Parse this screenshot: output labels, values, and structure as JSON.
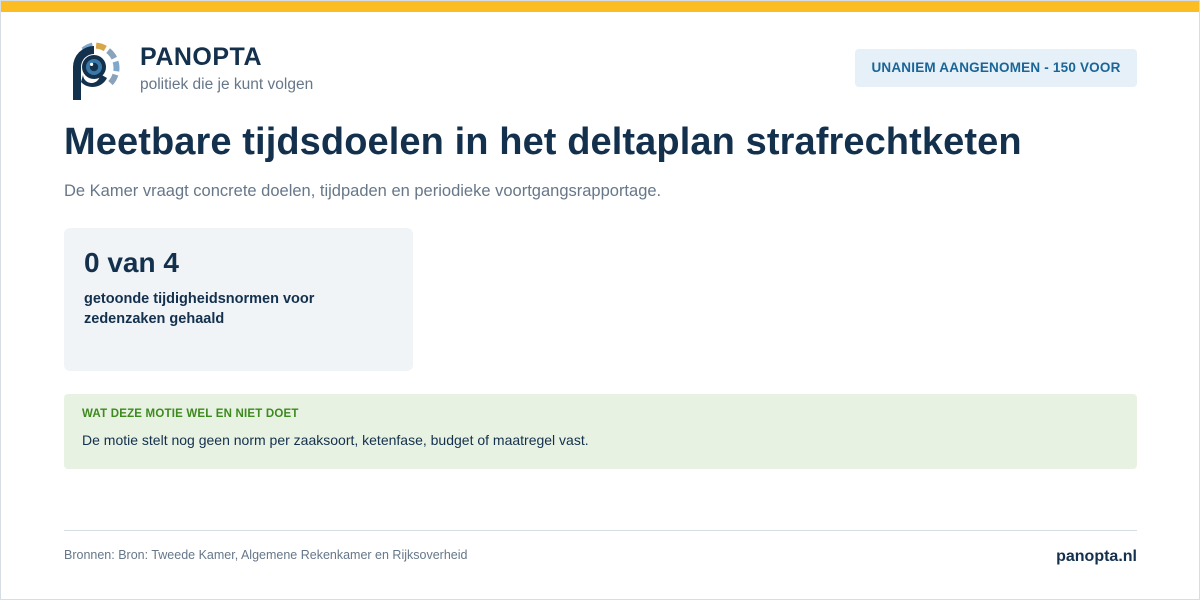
{
  "brand": {
    "name": "PANOPTA",
    "tagline": "politiek die je kunt volgen",
    "logo_icon": "panopta-eye-logo-icon"
  },
  "status": {
    "label": "UNANIEM AANGENOMEN - 150 VOOR"
  },
  "motion": {
    "title": "Meetbare tijdsdoelen in het deltaplan strafrechtketen",
    "summary": "De Kamer vraagt concrete doelen, tijdpaden en periodieke voortgangsrapportage."
  },
  "stat": {
    "value": "0 van 4",
    "label": "getoonde tijdigheidsnormen voor zedenzaken gehaald"
  },
  "info": {
    "heading": "WAT DEZE MOTIE WEL EN NIET DOET",
    "text": "De motie stelt nog geen norm per zaaksoort, ketenfase, budget of maatregel vast."
  },
  "footer": {
    "sources": "Bronnen: Bron: Tweede Kamer, Algemene Rekenkamer en Rijksoverheid",
    "site": "panopta.nl"
  },
  "colors": {
    "accent_bar": "#fbbd21",
    "navy": "#13304d",
    "muted": "#667789",
    "badge_bg": "#e6f0f8",
    "badge_text": "#1a6597",
    "card_bg": "#f1f4f7",
    "info_bg": "#e8f2e2",
    "info_heading": "#3d8a1f"
  }
}
